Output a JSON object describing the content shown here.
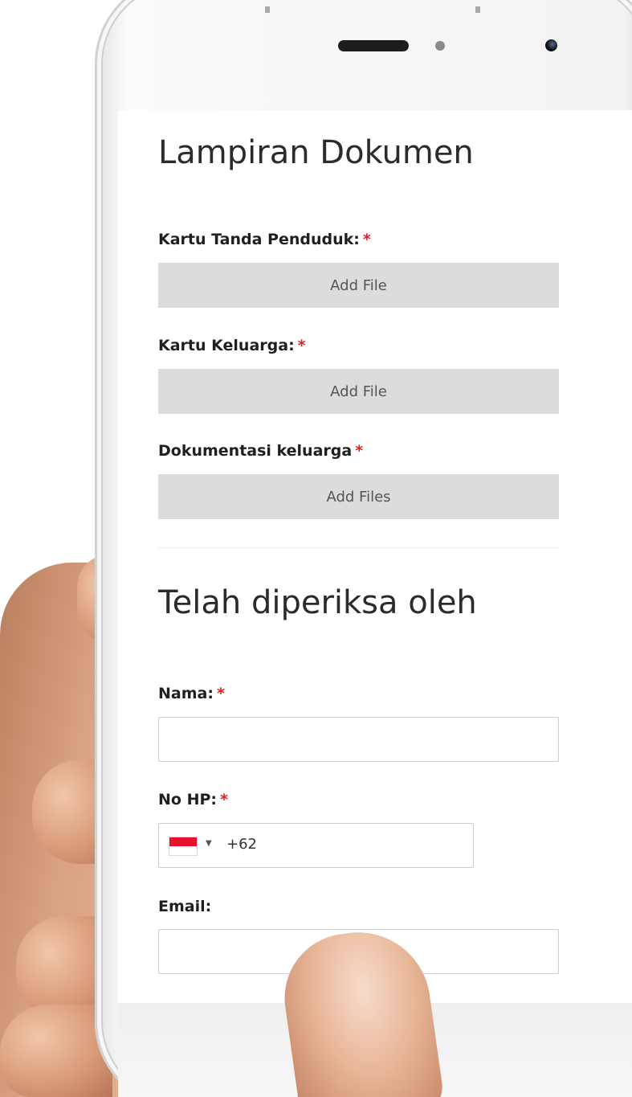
{
  "lampiran": {
    "title": "Lampiran Dokumen",
    "fields": [
      {
        "label": "Kartu Tanda Penduduk:",
        "required_mark": "*",
        "button_label": "Add File"
      },
      {
        "label": "Kartu Keluarga:",
        "required_mark": "*",
        "button_label": "Add File"
      },
      {
        "label": "Dokumentasi keluarga",
        "required_mark": "*",
        "button_label": "Add Files"
      }
    ]
  },
  "diperiksa": {
    "title": "Telah diperiksa oleh",
    "nama": {
      "label": "Nama:",
      "required_mark": "*",
      "value": ""
    },
    "no_hp": {
      "label": "No HP:",
      "required_mark": "*",
      "dial_code": "+62",
      "country_flag": "indonesia-flag-icon"
    },
    "email": {
      "label": "Email:",
      "value": ""
    }
  },
  "colors": {
    "required": "#e02020",
    "button_bg": "#dcdcdc",
    "title_text": "#2b2b2b"
  }
}
